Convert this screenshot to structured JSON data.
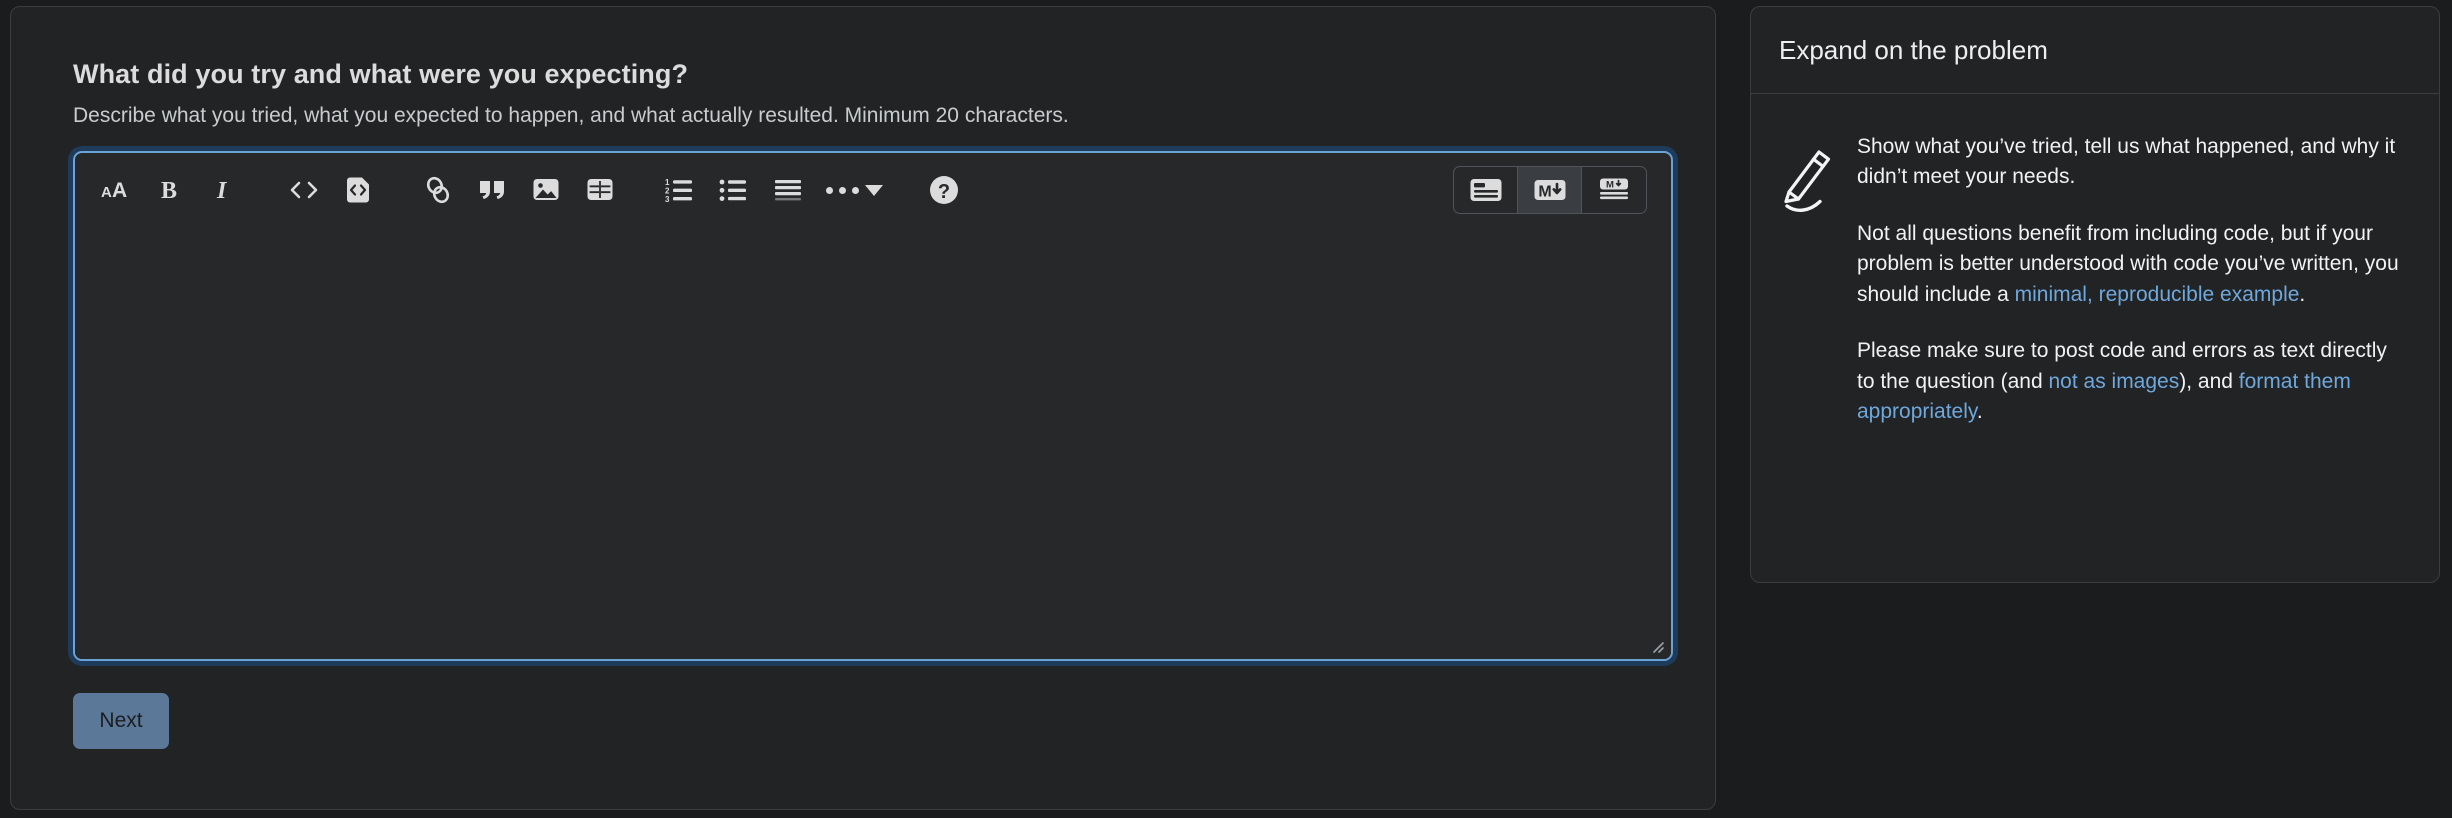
{
  "form": {
    "title": "What did you try and what were you expecting?",
    "description": "Describe what you tried, what you expected to happen, and what actually resulted. Minimum 20 characters.",
    "next_label": "Next",
    "body_value": "",
    "body_placeholder": ""
  },
  "toolbar": {
    "items": [
      {
        "name": "heading-icon",
        "label": "Heading"
      },
      {
        "name": "bold-icon",
        "label": "Bold"
      },
      {
        "name": "italic-icon",
        "label": "Italic"
      },
      {
        "name": "inline-code-icon",
        "label": "Inline code"
      },
      {
        "name": "code-block-icon",
        "label": "Code block"
      },
      {
        "name": "link-icon",
        "label": "Link"
      },
      {
        "name": "blockquote-icon",
        "label": "Blockquote"
      },
      {
        "name": "image-icon",
        "label": "Image"
      },
      {
        "name": "table-icon",
        "label": "Table"
      },
      {
        "name": "ordered-list-icon",
        "label": "Numbered list"
      },
      {
        "name": "bulleted-list-icon",
        "label": "Bulleted list"
      },
      {
        "name": "horizontal-rule-icon",
        "label": "Horizontal rule"
      },
      {
        "name": "more-formatting-icon",
        "label": "More"
      },
      {
        "name": "help-icon",
        "label": "Help"
      }
    ],
    "modes": [
      {
        "name": "rich-text-mode",
        "label": "Rich text",
        "active": false
      },
      {
        "name": "markdown-mode",
        "label": "Markdown",
        "active": true
      },
      {
        "name": "split-view-mode",
        "label": "Split view",
        "active": false
      }
    ]
  },
  "sidebar": {
    "heading": "Expand on the problem",
    "icon": "pencil-icon",
    "paragraph1": "Show what you’ve tried, tell us what happened, and why it didn’t meet your needs.",
    "paragraph2_before": "Not all questions benefit from including code, but if your problem is better understood with code you’ve written, you should include a ",
    "paragraph2_link": "minimal, reproducible example",
    "paragraph2_after": ".",
    "paragraph3_before": "Please make sure to post code and errors as text directly to the question (and ",
    "paragraph3_link1": "not as images",
    "paragraph3_middle": "), and ",
    "paragraph3_link2": "format them appropriately",
    "paragraph3_after": "."
  },
  "colors": {
    "page_bg": "#1a1c1d",
    "card_bg": "#212325",
    "card_border": "#3b3d3f",
    "focus_ring": "#6ba3d6",
    "focus_glow": "#1f3b5c",
    "link": "#6fa8dc",
    "button_bg": "#5b7899",
    "icon": "#dcdcdc"
  }
}
